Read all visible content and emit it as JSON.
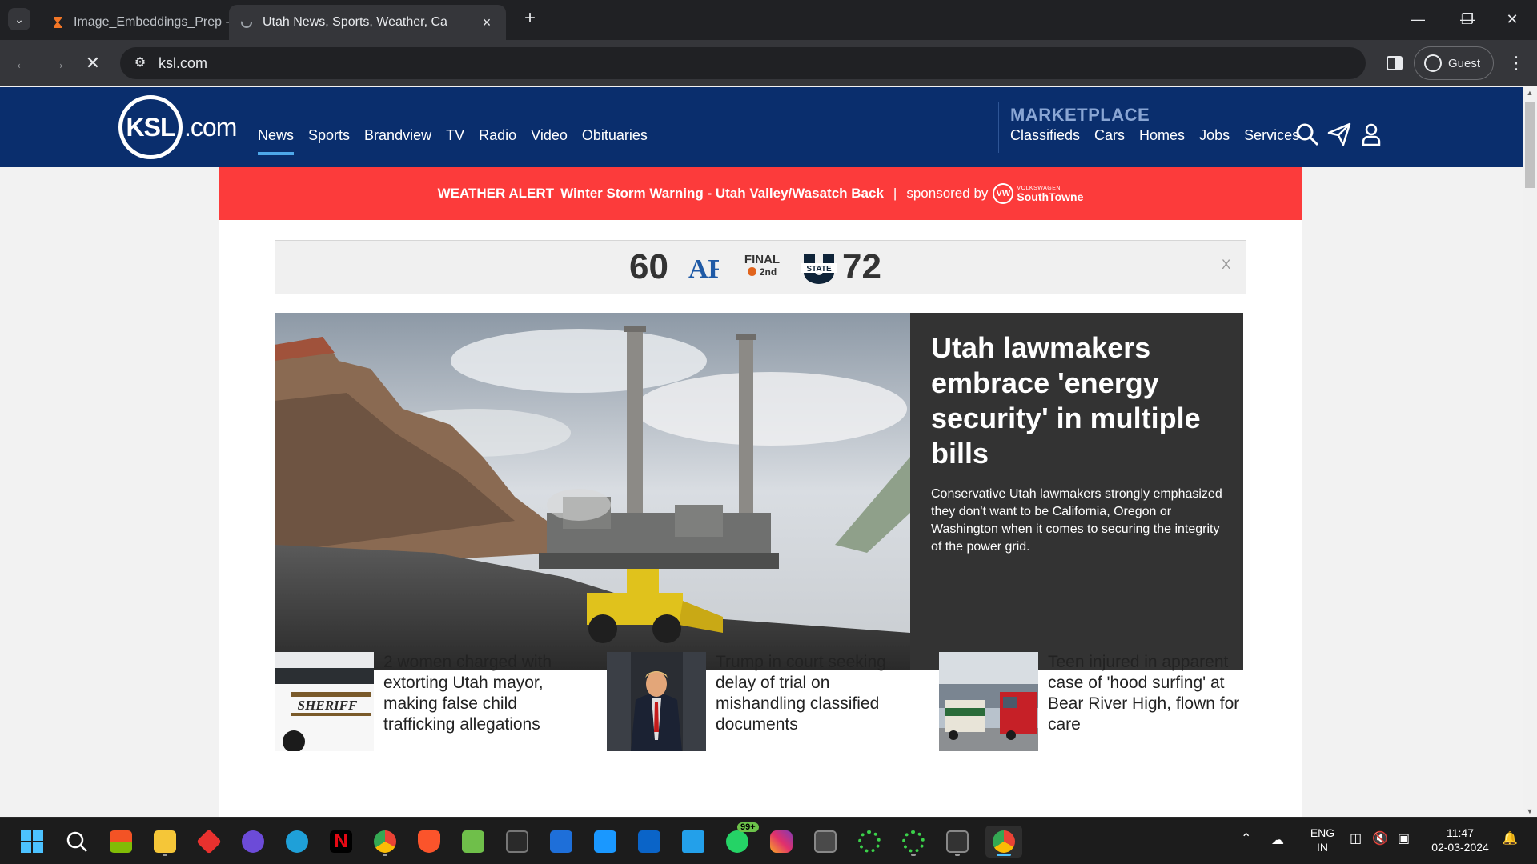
{
  "browser": {
    "tabs": [
      {
        "title": "Image_Embeddings_Prep - Jupyter",
        "active": false
      },
      {
        "title": "Utah News, Sports, Weather, Ca",
        "active": true
      }
    ],
    "new_tab_label": "+",
    "url": "ksl.com",
    "profile_label": "Guest"
  },
  "site": {
    "logo_main": "KSL",
    "logo_suffix": ".com",
    "nav": [
      {
        "label": "News",
        "active": true
      },
      {
        "label": "Sports"
      },
      {
        "label": "Brandview"
      },
      {
        "label": "TV"
      },
      {
        "label": "Radio"
      },
      {
        "label": "Video"
      },
      {
        "label": "Obituaries"
      }
    ],
    "marketplace_label": "MARKETPLACE",
    "marketplace_nav": [
      "Classifieds",
      "Cars",
      "Homes",
      "Jobs",
      "Services"
    ]
  },
  "weather_alert": {
    "label": "WEATHER ALERT",
    "text": "Winter Storm Warning - Utah Valley/Wasatch Back",
    "separator": "|",
    "sponsored_by": "sponsored by",
    "sponsor_top": "VOLKSWAGEN",
    "sponsor_name": "SouthTowne"
  },
  "scoreboard": {
    "away_score": "60",
    "away_team_logo": "AF",
    "status": "FINAL",
    "period": "2nd",
    "home_team_logo": "STATE",
    "home_score": "72",
    "close_label": "X"
  },
  "hero": {
    "headline": "Utah lawmakers embrace 'energy security' in multiple bills",
    "summary": "Conservative Utah lawmakers strongly emphasized they don't want to be California, Oregon or Washington when it comes to securing the integrity of the power grid."
  },
  "stories": [
    {
      "headline": "2 women charged with extorting Utah mayor, making false child trafficking allegations",
      "thumb_text": "SHERIFF"
    },
    {
      "headline": "Trump in court seeking delay of trial on mishandling classified documents"
    },
    {
      "headline": "Teen injured in apparent case of 'hood surfing' at Bear River High, flown for care"
    }
  ],
  "taskbar": {
    "notification_badge": "99+",
    "language_line1": "ENG",
    "language_line2": "IN",
    "time": "11:47",
    "date": "02-03-2024"
  },
  "colors": {
    "ksl_navy": "#0a2e6d",
    "alert_red": "#fc3b3b",
    "hero_panel": "#333333",
    "nav_active": "#4ea8ea"
  }
}
